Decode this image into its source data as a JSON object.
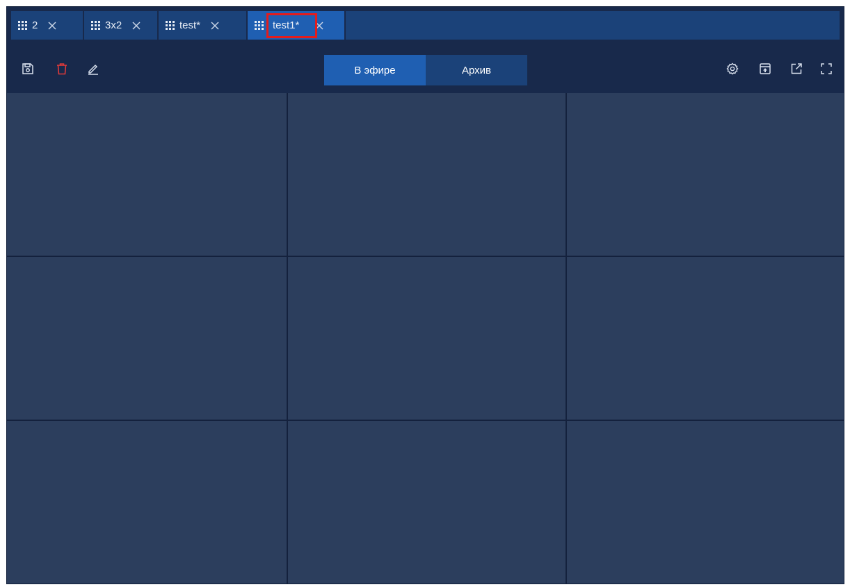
{
  "tabs": [
    {
      "label": "2",
      "icon": "grid-icon",
      "close_icon": "close-icon",
      "active": false
    },
    {
      "label": "3x2",
      "icon": "grid-icon",
      "close_icon": "close-icon",
      "active": false
    },
    {
      "label": "test*",
      "icon": "grid-icon",
      "close_icon": "close-icon",
      "active": false
    },
    {
      "label": "test1*",
      "icon": "grid-icon",
      "close_icon": "close-icon",
      "active": true
    }
  ],
  "toolbar": {
    "left_icons": [
      "save-icon",
      "trash-icon",
      "edit-icon"
    ],
    "right_icons": [
      "settings-icon",
      "layout-icon",
      "external-window-icon",
      "fullscreen-icon"
    ],
    "mode_tabs": {
      "live_label": "В эфире",
      "archive_label": "Архив",
      "active": "live"
    }
  },
  "layout_grid": {
    "rows": 3,
    "columns": 3
  },
  "colors": {
    "background": "#18294b",
    "tab": "#1b4279",
    "tab_active": "#1f5fb2",
    "cell": "#2c3e5d",
    "delete_icon": "#e03a3a",
    "highlight": "#e31c1c"
  }
}
